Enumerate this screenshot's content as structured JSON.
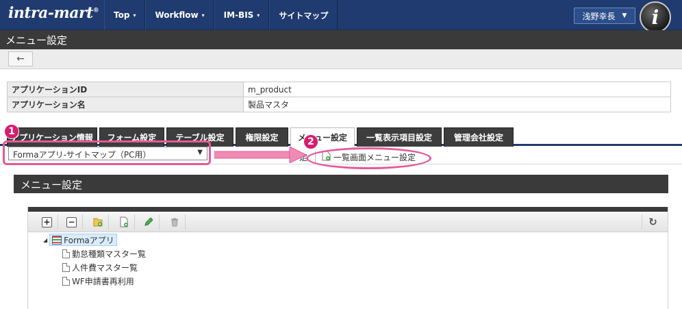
{
  "header": {
    "logo": "intra-mart",
    "logo_mark": "®",
    "nav": [
      {
        "label": "Top",
        "caret": "▾"
      },
      {
        "label": "Workflow",
        "caret": "▾"
      },
      {
        "label": "IM-BIS",
        "caret": "▾"
      },
      {
        "label": "サイトマップ",
        "caret": ""
      }
    ],
    "user_name": "浅野幸長",
    "user_caret": "▼",
    "avatar_letter": "i"
  },
  "page_title": "メニュー設定",
  "back_icon": "←",
  "info": [
    {
      "label": "アプリケーションID",
      "value": "m_product"
    },
    {
      "label": "アプリケーション名",
      "value": "製品マスタ"
    }
  ],
  "tabs": [
    "アプリケーション情報",
    "フォーム設定",
    "テーブル設定",
    "権限設定",
    "メニュー設定",
    "一覧表示項目設定",
    "管理会社設定"
  ],
  "active_tab": 4,
  "subbar": {
    "select_value": "Formaアプリ-サイトマップ（PC用）",
    "select_arrow": "▼",
    "left_item": "定",
    "menu_button": "一覧画面メニュー設定"
  },
  "section_title": "メニュー設定",
  "toolbar": {
    "expand": "+",
    "collapse": "−",
    "refresh": "↻"
  },
  "tree": {
    "toggle": "◢",
    "root": "Formaアプリ",
    "children": [
      "勤怠種類マスター覧",
      "人件費マスター覧",
      "WF申請書再利用"
    ]
  },
  "annotations": {
    "badge1": "1",
    "badge2": "2"
  },
  "colors": {
    "nav_bg": "#1f3b6f",
    "highlight": "#e45a97",
    "badge": "#d81b6e"
  }
}
